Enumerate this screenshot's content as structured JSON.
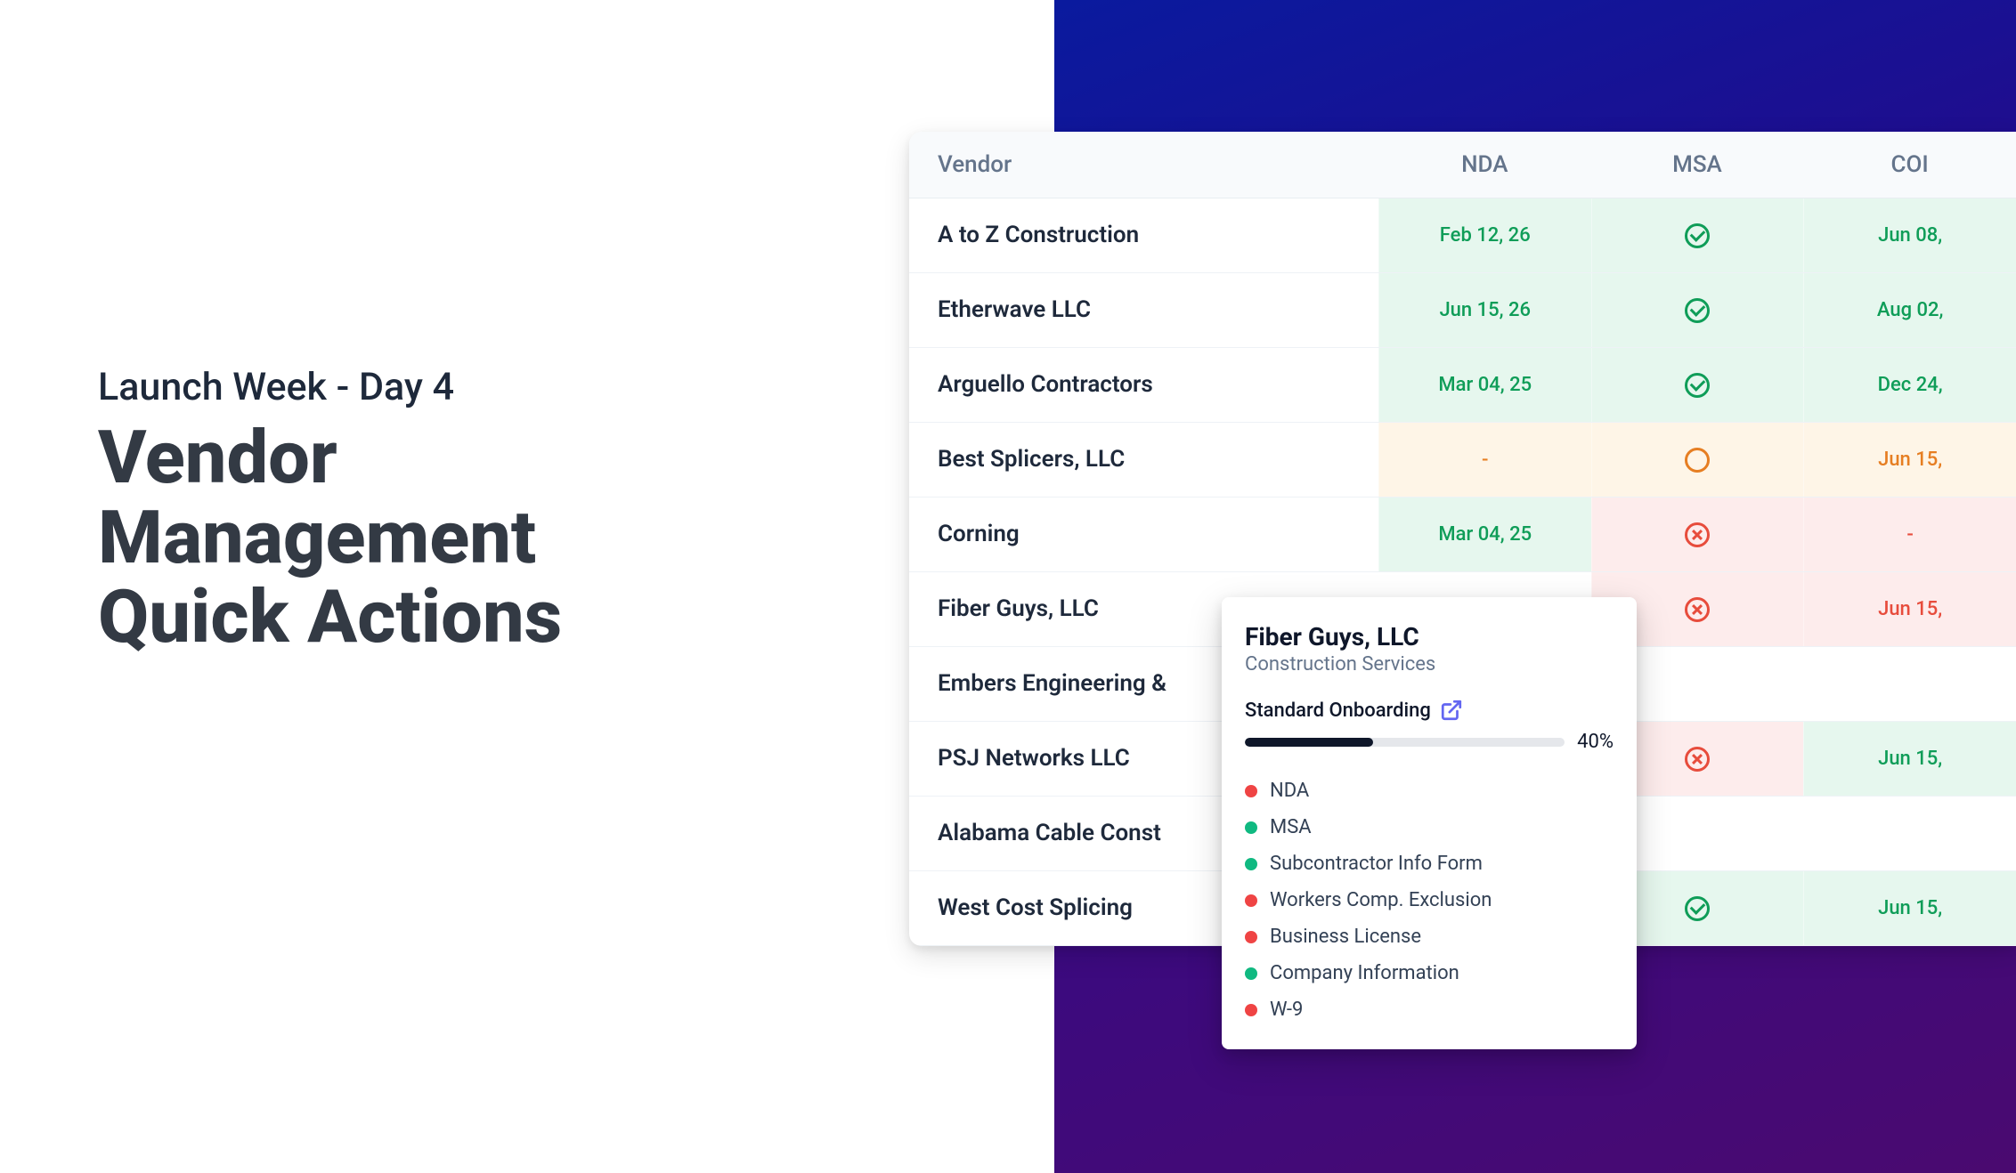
{
  "hero": {
    "subtitle": "Launch Week - Day 4",
    "title_line1": "Vendor",
    "title_line2": "Management",
    "title_line3": "Quick Actions"
  },
  "table": {
    "headers": {
      "vendor": "Vendor",
      "nda": "NDA",
      "msa": "MSA",
      "coi": "COI"
    },
    "rows": [
      {
        "vendor": "A to Z Construction",
        "nda": {
          "text": "Feb 12, 26",
          "state": "g"
        },
        "msa": {
          "icon": "check",
          "state": "g"
        },
        "coi": {
          "text": "Jun 08,",
          "state": "g"
        }
      },
      {
        "vendor": "Etherwave LLC",
        "nda": {
          "text": "Jun 15, 26",
          "state": "g"
        },
        "msa": {
          "icon": "check",
          "state": "g"
        },
        "coi": {
          "text": "Aug 02,",
          "state": "g"
        }
      },
      {
        "vendor": "Arguello Contractors",
        "nda": {
          "text": "Mar 04, 25",
          "state": "g"
        },
        "msa": {
          "icon": "check",
          "state": "g"
        },
        "coi": {
          "text": "Dec 24,",
          "state": "g"
        }
      },
      {
        "vendor": "Best Splicers, LLC",
        "nda": {
          "text": "-",
          "state": "o"
        },
        "msa": {
          "icon": "hollow",
          "state": "o"
        },
        "coi": {
          "text": "Jun 15,",
          "state": "o"
        }
      },
      {
        "vendor": "Corning",
        "nda": {
          "text": "Mar 04, 25",
          "state": "g"
        },
        "msa": {
          "icon": "x",
          "state": "r"
        },
        "coi": {
          "text": "-",
          "state": "r"
        }
      },
      {
        "vendor": "Fiber Guys, LLC",
        "nda": {
          "text": "",
          "state": ""
        },
        "msa": {
          "icon": "x",
          "state": "r"
        },
        "coi": {
          "text": "Jun 15,",
          "state": "r"
        }
      },
      {
        "vendor": "Embers Engineering &",
        "nda": {
          "text": "",
          "state": ""
        },
        "msa": {
          "icon": "",
          "state": ""
        },
        "coi": {
          "text": "",
          "state": ""
        }
      },
      {
        "vendor": "PSJ Networks LLC",
        "nda": {
          "text": "",
          "state": ""
        },
        "msa": {
          "icon": "x",
          "state": "r"
        },
        "coi": {
          "text": "Jun 15,",
          "state": "g"
        }
      },
      {
        "vendor": "Alabama Cable Const",
        "nda": {
          "text": "",
          "state": ""
        },
        "msa": {
          "icon": "",
          "state": ""
        },
        "coi": {
          "text": "",
          "state": ""
        }
      },
      {
        "vendor": "West Cost Splicing",
        "nda": {
          "text": "",
          "state": ""
        },
        "msa": {
          "icon": "check",
          "state": "g"
        },
        "coi": {
          "text": "Jun 15,",
          "state": "g"
        }
      }
    ]
  },
  "popover": {
    "title": "Fiber Guys, LLC",
    "subtitle": "Construction Services",
    "section_label": "Standard Onboarding",
    "progress_pct": 40,
    "progress_label": "40%",
    "docs": [
      {
        "name": "NDA",
        "status": "r"
      },
      {
        "name": "MSA",
        "status": "g"
      },
      {
        "name": "Subcontractor Info Form",
        "status": "g"
      },
      {
        "name": "Workers Comp. Exclusion",
        "status": "r"
      },
      {
        "name": "Business License",
        "status": "r"
      },
      {
        "name": "Company Information",
        "status": "g"
      },
      {
        "name": "W-9",
        "status": "r"
      }
    ]
  }
}
